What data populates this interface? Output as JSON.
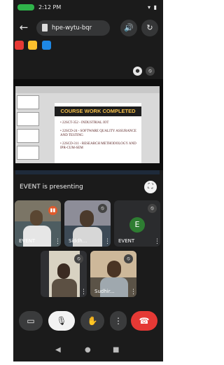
{
  "status_bar": {
    "time": "2:12 PM",
    "icons_text": "▾ ▮"
  },
  "meet_bar": {
    "back_glyph": "←",
    "meeting_code": "hpe-wytu-bqr",
    "speaker_glyph": "🔊",
    "switch_camera_glyph": "↻"
  },
  "apps": [
    {
      "name": "record-app-icon",
      "color": "#e53935"
    },
    {
      "name": "notes-app-icon",
      "color": "#fbc02d"
    },
    {
      "name": "tools-app-icon",
      "color": "#1e88e5"
    }
  ],
  "presentation": {
    "slide_title": "COURSE WORK COMPLETED",
    "items": [
      "• 22SCT-352 - INDUSTRIAL IOT",
      "• 22SCD-24 - SOFTWARE QUALITY ASSURANCE AND TESTING",
      "• 22SCD-311 - RESEARCH METHODOLOGY AND IPR-CUM-SEM"
    ],
    "presenting_label": "EVENT is presenting"
  },
  "participants": [
    {
      "name": "EVENT",
      "type": "video",
      "bg": "#4e5d61",
      "wall": "#7b7566",
      "person": "#5a4632",
      "shirt": "#e6e6e6"
    },
    {
      "name": "Siddh...",
      "type": "video",
      "bg": "#3d4a56",
      "wall": "#8d8d98",
      "person": "#4b3a2c",
      "shirt": "#d7d7d7"
    },
    {
      "name": "EVENT",
      "type": "avatar",
      "bg": "#2b2c2e",
      "initial": "E"
    },
    {
      "name": "",
      "type": "video",
      "bg": "#2f3033",
      "wall": "#d8d2c2",
      "person": "#3b2b22",
      "shirt": "#5c5043"
    },
    {
      "name": "Sudhir...",
      "type": "video",
      "bg": "#5b5347",
      "wall": "#cdb89a",
      "person": "#4a3424",
      "shirt": "#9fa8ae"
    }
  ],
  "controls": {
    "camera_glyph": "▭",
    "mic_off_glyph": "🎙",
    "raise_hand_glyph": "✋",
    "more_glyph": "⋮",
    "end_call_glyph": "☎",
    "end_call_color": "#e53935"
  },
  "nav": {
    "back": "◀",
    "home": "●",
    "recents": "■"
  }
}
